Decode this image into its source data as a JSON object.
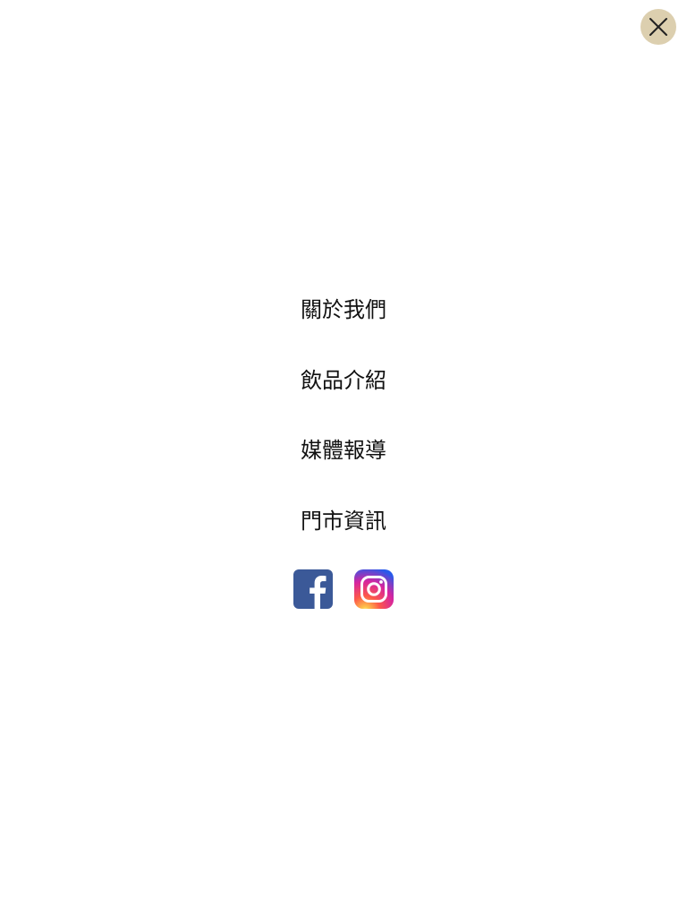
{
  "header": {
    "close_icon": "close-icon",
    "close_button_color": "#dccfaf"
  },
  "menu": {
    "items": [
      {
        "label": "關於我們"
      },
      {
        "label": "飲品介紹"
      },
      {
        "label": "媒體報導"
      },
      {
        "label": "門市資訊"
      }
    ]
  },
  "social": {
    "facebook": {
      "icon": "facebook-icon",
      "color": "#3b5998"
    },
    "instagram": {
      "icon": "instagram-icon",
      "color": "#d6249f"
    }
  }
}
